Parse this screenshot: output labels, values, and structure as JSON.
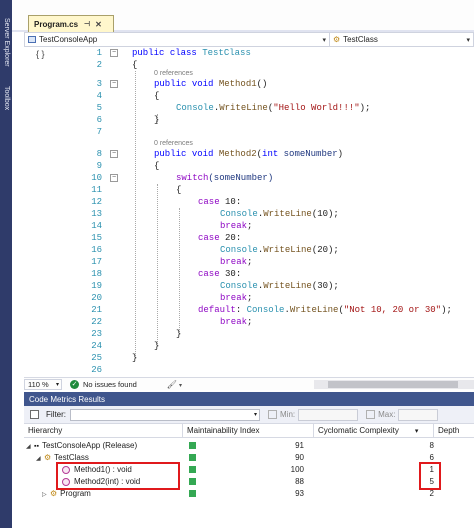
{
  "sidebar_tools": [
    "Server Explorer",
    "Toolbox"
  ],
  "tab": {
    "title": "Program.cs",
    "pin_icon": "pin-icon",
    "close": "✕"
  },
  "navbar": {
    "project": "TestConsoleApp",
    "class": "TestClass"
  },
  "editor": {
    "line_numbers": [
      "1",
      "2",
      "3",
      "4",
      "5",
      "6",
      "7",
      "8",
      "9",
      "10",
      "11",
      "12",
      "13",
      "14",
      "15",
      "16",
      "17",
      "18",
      "19",
      "20",
      "21",
      "22",
      "23",
      "24",
      "25",
      "26"
    ],
    "references": [
      "0 references",
      "0 references"
    ],
    "lines": {
      "l1": [
        "public",
        "class",
        "TestClass"
      ],
      "l2": "{",
      "l3": [
        "public",
        "void",
        "Method1",
        "()"
      ],
      "l4": "{",
      "l5": [
        "Console",
        ".",
        "WriteLine",
        "(",
        "\"Hello World!!!\"",
        ");"
      ],
      "l6": "}",
      "l8": [
        "public",
        "void",
        "Method2",
        "(",
        "int",
        "someNumber",
        ")"
      ],
      "l9": "{",
      "l10": [
        "switch",
        "(someNumber)"
      ],
      "l11": "{",
      "l12": [
        "case",
        "10:"
      ],
      "l13": [
        "Console",
        ".",
        "WriteLine",
        "(10);"
      ],
      "l14": [
        "break",
        ";"
      ],
      "l15": [
        "case",
        "20:"
      ],
      "l16": [
        "Console",
        ".",
        "WriteLine",
        "(20);"
      ],
      "l17": [
        "break",
        ";"
      ],
      "l18": [
        "case",
        "30:"
      ],
      "l19": [
        "Console",
        ".",
        "WriteLine",
        "(30);"
      ],
      "l20": [
        "break",
        ";"
      ],
      "l21": [
        "default",
        ":",
        "Console",
        ".",
        "WriteLine",
        "(",
        "\"Not 10, 20 or 30\"",
        ");"
      ],
      "l22": [
        "break",
        ";"
      ],
      "l23": "}",
      "l24": "}",
      "l25": "}"
    }
  },
  "status": {
    "zoom": "110 %",
    "issues": "No issues found"
  },
  "metrics": {
    "title": "Code Metrics Results",
    "filter_label": "Filter:",
    "min_label": "Min:",
    "max_label": "Max:",
    "columns": [
      "Hierarchy",
      "Maintainability Index",
      "Cyclomatic Complexity",
      "Depth"
    ],
    "rows": [
      {
        "name": "TestConsoleApp (Release)",
        "mi": "91",
        "cc": "8"
      },
      {
        "name": "TestClass",
        "mi": "90",
        "cc": "6"
      },
      {
        "name": "Method1() : void",
        "mi": "100",
        "cc": "1"
      },
      {
        "name": "Method2(int) : void",
        "mi": "88",
        "cc": "5"
      },
      {
        "name": "Program",
        "mi": "93",
        "cc": "2"
      }
    ]
  },
  "colors": {
    "accent": "#40568d",
    "highlight": "#e0191c",
    "ok": "#34a853"
  }
}
